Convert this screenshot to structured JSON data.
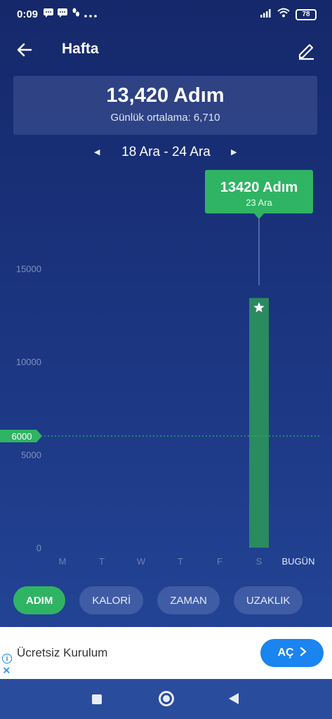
{
  "status_bar": {
    "time": "0:09",
    "battery": "78"
  },
  "header": {
    "title": "Hafta"
  },
  "summary": {
    "total": "13,420 Adım",
    "average_label": "Günlük ortalama:",
    "average_value": "6,710"
  },
  "date_nav": {
    "range": "18 Ara - 24 Ara"
  },
  "chart_data": {
    "type": "bar",
    "categories": [
      "M",
      "T",
      "W",
      "T",
      "F",
      "S",
      "BUGÜN"
    ],
    "values": [
      0,
      0,
      0,
      0,
      0,
      13420,
      0
    ],
    "y_ticks": [
      "15000",
      "10000",
      "5000",
      "0"
    ],
    "ylim": [
      0,
      20000
    ],
    "goal_line": {
      "value": 6000,
      "label": "6000"
    },
    "tooltip": {
      "value": "13420 Adım",
      "date": "23 Ara",
      "category_index": 5
    },
    "bar_color": "#2a8a60",
    "goal_color": "#2fb463",
    "grid": false
  },
  "tabs": [
    {
      "label": "ADIM",
      "active": true
    },
    {
      "label": "KALORİ",
      "active": false
    },
    {
      "label": "ZAMAN",
      "active": false
    },
    {
      "label": "UZAKLIK",
      "active": false
    }
  ],
  "ad": {
    "text": "Ücretsiz Kurulum",
    "button_label": "AÇ"
  },
  "colors": {
    "accent": "#2fb463",
    "ad_button": "#1a84f0"
  }
}
